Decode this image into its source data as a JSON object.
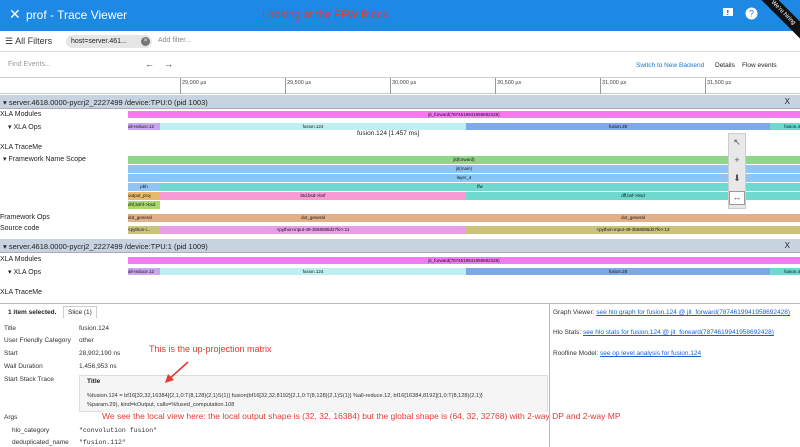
{
  "appbar": {
    "title": "prof - Trace Viewer",
    "annotation": "Looking at the FFW Block",
    "ribbon": "We're hiring",
    "icons": [
      "xprof-logo-icon",
      "feedback-icon",
      "help-icon"
    ]
  },
  "filters": {
    "all_filters": "All Filters",
    "chip": "host=server.461...",
    "add_placeholder": "Add filter..."
  },
  "toolbar": {
    "find_placeholder": "Find Events...",
    "prev": "←",
    "next": "→",
    "switch_backend": "Switch to New Backend",
    "details": "Details",
    "flow_events": "Flow events"
  },
  "ruler": {
    "ticks": [
      "29,000 µs",
      "29,500 µs",
      "30,000 µs",
      "30,500 µs",
      "31,000 µs",
      "31,500 µs"
    ]
  },
  "process1": {
    "header": "server.4618.0000-pycrj2_2227499 /device:TPU:0 (pid 1003)",
    "close": "X",
    "rows": [
      "XLA Modules",
      "XLA Ops",
      "XLA TraceMe",
      "Framework Name Scope",
      "Framework Ops",
      "Source code"
    ],
    "bars": {
      "module": "jit_forward(7874619941958692428)",
      "allreduce": "all-reduce.12",
      "fusion124": "fusion.124",
      "fusion28": "fusion.28",
      "fusion4": "fusion.4",
      "jit_forward": "jit(forward)",
      "jit_main": "jit(main)",
      "layer4": "layer_4",
      "ffw": "ffw",
      "output_proj": "output_proj",
      "pbh": "pbh",
      "btd": "btd,bsd->bsf",
      "dff": "dff,bsf->bsd",
      "dhf": "dhf,bshf->bsd",
      "dot_general": "dot_general",
      "src_a": "<python-i...",
      "src_b": "<python-input-49-3b58086d27fe>:11",
      "src_c": "<python-input-49-3b58086d27fe>:13"
    },
    "tooltip": "fusion.124 [1.457 ms]"
  },
  "process2": {
    "header": "server.4618.0000-pycrj2_2227499 /device:TPU:1 (pid 1009)",
    "close": "X",
    "rows": [
      "XLA Modules",
      "XLA Ops",
      "XLA TraceMe"
    ],
    "bars": {
      "module": "jit_forward(7874619941958692428)",
      "allreduce": "all-reduce.12",
      "fusion124": "fusion.124",
      "fusion28": "fusion.28",
      "fusion4": "fusion.4"
    }
  },
  "details": {
    "selected": "1 item selected.",
    "slice_tab": "Slice (1)",
    "fields": {
      "title_k": "Title",
      "title_v": "fusion.124",
      "cat_k": "User Friendly Category",
      "cat_v": "other",
      "start_k": "Start",
      "start_v": "28,902,190 ns",
      "wall_k": "Wall Duration",
      "wall_v": "1,456,953 ns",
      "stack_k": "Start Stack Trace"
    },
    "stack_title": "Title",
    "stack_line1": "%fusion.124 = bf16[32,32,16384]{2,1,0:T(8,128)(2,1)S(1)} fusion(bf16[32,32,8192]{2,1,0:T(8,128)(2,1)S(1)} %all-reduce.12, bf16[16384,8192]{1,0:T(8,128)(2,1)}",
    "stack_line2": "%param.29), kind=kOutput, calls=%fused_computation.108",
    "args_k": "Args",
    "hlo_cat_k": "hlo_category",
    "hlo_cat_v": "\"convolution fusion\"",
    "dedup_k": "deduplicated_name",
    "dedup_v": "\"fusion.112\""
  },
  "annotations": {
    "upproj": "This is the up-projection matrix",
    "local_view": "We see the local view here: the local output shape is (32, 32, 16384) but the global shape is (64, 32, 32768) with 2-way DP and 2-way MP"
  },
  "right_pane": {
    "graph_k": "Graph Viewer:",
    "graph_v": "see hlo graph for fusion.124 @ jit_forward(7874619941958692428)",
    "stats_k": "Hlo Stats:",
    "stats_v": "see hlo stats for fusion.124 @ jit_forward(7874619941958692428)",
    "roof_k": "Roofline Model:",
    "roof_v": "see op level analysis for fusion.124"
  },
  "colors": {
    "appbar": "#1e88e5",
    "module_pink": "#f07cf0",
    "fusion_teal": "#bfeff0",
    "fusion_blue": "#7fa8e8",
    "scope_green": "#8fd68a",
    "scope_blue": "#8ec5f5",
    "ffw_teal": "#6fd8cf",
    "pink_bar": "#f79ad6",
    "dot_orange": "#e2b088",
    "src_purple": "#e89ee8",
    "src_olive": "#c9c47a",
    "annotation_red": "#e53935"
  }
}
